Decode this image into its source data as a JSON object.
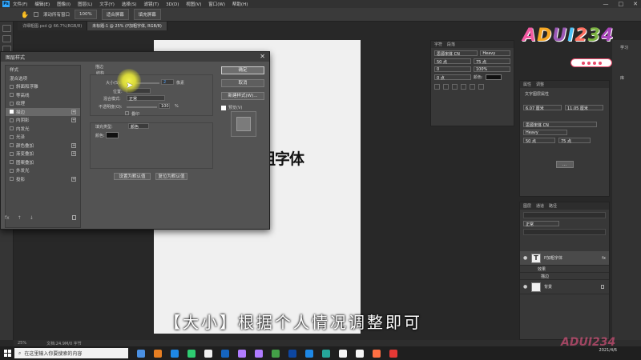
{
  "app": {
    "logo": "Ps",
    "menu": [
      "文件(F)",
      "编辑(E)",
      "图像(I)",
      "图层(L)",
      "文字(Y)",
      "选择(S)",
      "滤镜(T)",
      "3D(D)",
      "视图(V)",
      "窗口(W)",
      "帮助(H)"
    ],
    "window_controls": [
      "—",
      "□",
      "✕"
    ]
  },
  "options_bar": {
    "scroll_all": "滚动所有窗口",
    "zoom": "100%",
    "fit_screen": "适合屏幕",
    "fill_screen": "填充屏幕"
  },
  "doc_tabs": [
    {
      "label": "详细粗图.psd @ 66.7%(RGB/8)",
      "active": false
    },
    {
      "label": "未标题-1 @ 25% (P加粗字体, RGB/8)",
      "active": true
    }
  ],
  "canvas": {
    "text": "粗字体"
  },
  "subtitle": "【大小】根据个人情况调整即可",
  "status": {
    "zoom": "25%",
    "doc": "文档:24.9M/0 字节"
  },
  "dialog": {
    "title": "图层样式",
    "close": "✕",
    "styles_header": "样式",
    "blend_options": "混合选项",
    "style_items": [
      {
        "label": "斜面和浮雕",
        "checked": false,
        "plus": false
      },
      {
        "label": "等高线",
        "checked": false,
        "plus": false
      },
      {
        "label": "纹理",
        "checked": false,
        "plus": false
      },
      {
        "label": "描边",
        "checked": true,
        "plus": true,
        "selected": true
      },
      {
        "label": "内阴影",
        "checked": false,
        "plus": true
      },
      {
        "label": "内发光",
        "checked": false,
        "plus": false
      },
      {
        "label": "光泽",
        "checked": false,
        "plus": false
      },
      {
        "label": "颜色叠加",
        "checked": false,
        "plus": true
      },
      {
        "label": "渐变叠加",
        "checked": false,
        "plus": true
      },
      {
        "label": "图案叠加",
        "checked": false,
        "plus": false
      },
      {
        "label": "外发光",
        "checked": false,
        "plus": false
      },
      {
        "label": "投影",
        "checked": false,
        "plus": true
      }
    ],
    "footer_icons": [
      "fx",
      "↑",
      "↓",
      "🗑"
    ],
    "stroke": {
      "section": "描边",
      "structure": "结构",
      "size_label": "大小(S):",
      "size_value": "2",
      "size_unit": "像素",
      "position_label": "位置:",
      "blend_label": "混合模式:",
      "blend_value": "正常",
      "opacity_label": "不透明度(O):",
      "opacity_value": "100",
      "opacity_unit": "%",
      "overprint": "叠印",
      "fill_type_label": "填充类型:",
      "fill_type_value": "颜色",
      "color_label": "颜色:"
    },
    "set_default": "设置为默认值",
    "reset_default": "复位为默认值",
    "buttons": {
      "ok": "确定",
      "cancel": "取消",
      "new_style": "新建样式(W)...",
      "preview": "预览(V)"
    }
  },
  "char_panel": {
    "tabs": [
      "字符",
      "段落"
    ],
    "font": "思源宋体 CN",
    "weight": "Heavy",
    "size": "50 点",
    "leading": "75 点",
    "tracking": "0",
    "scale": "100%",
    "baseline": "0 点",
    "color_label": "颜色:"
  },
  "props_panel": {
    "tabs": [
      "属性",
      "调整"
    ],
    "section": "文字图层属性",
    "w": "6.07 厘米",
    "h": "11.05 厘米",
    "font": "思源宋体 CN",
    "weight": "Heavy",
    "size": "50 点",
    "leading": "75 点",
    "more": "..."
  },
  "layers_panel": {
    "tabs": [
      "图层",
      "通道",
      "路径"
    ],
    "mode": "正常",
    "layers": [
      {
        "name": "P加粗字体",
        "fx": "fx",
        "type": "text",
        "selected": true
      },
      {
        "name": "效果",
        "sub": true
      },
      {
        "name": "描边",
        "sub": true
      },
      {
        "name": "背景",
        "type": "bg"
      }
    ]
  },
  "right_strip": {
    "learn": "学习",
    "sample": "库"
  },
  "logo": {
    "text": "ADUI234",
    "colors": [
      "#f25aa3",
      "#f5a623",
      "#9b59b6",
      "#4fc3f7",
      "#ff6f61",
      "#7cb342",
      "#ab47bc"
    ]
  },
  "taskbar": {
    "search_placeholder": "在这里输入你要搜索的内容",
    "time": "",
    "date": "2021/4/6",
    "icons": [
      "#4a90e2",
      "#e67e22",
      "#1e88e5",
      "#2ecc71",
      "#f0f0f0",
      "#1565c0",
      "#b07cff",
      "#b07cff",
      "#43a047",
      "#0d47a1",
      "#1e88e5",
      "#26a69a",
      "#f5f5f5",
      "#f5f5f5",
      "#ff7043",
      "#e53935"
    ]
  }
}
